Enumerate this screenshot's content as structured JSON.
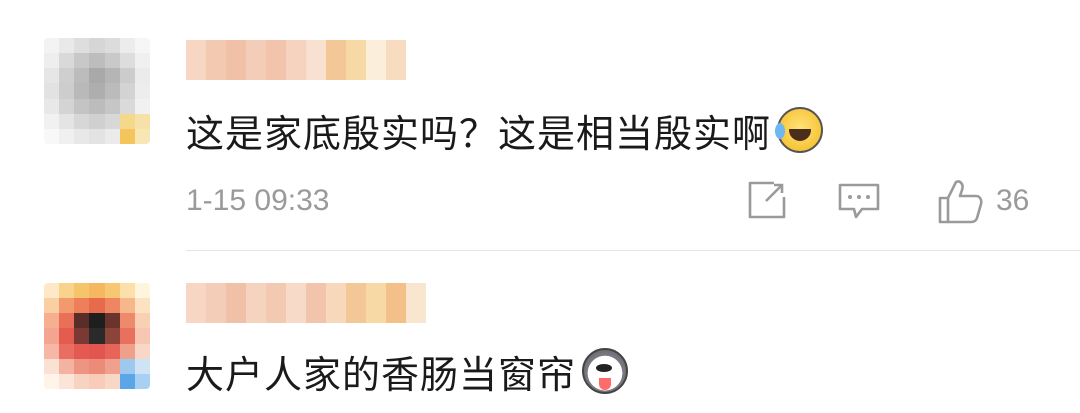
{
  "comments": [
    {
      "username": "",
      "text": "这是家底殷实吗？这是相当殷实啊",
      "emoji": "laughing-crying-emoji",
      "timestamp": "1-15 09:33",
      "like_count": "36",
      "avatar_colors": [
        "#f3f3f3",
        "#e9e9e9",
        "#dedede",
        "#d6d6d6",
        "#dcdcdc",
        "#ececec",
        "#f6f6f6",
        "#eeeeee",
        "#d9d9d9",
        "#c8c8c8",
        "#bdbdbd",
        "#c9c9c9",
        "#dddddd",
        "#f0f0f0",
        "#e6e6e6",
        "#cfcfcf",
        "#bcbcbc",
        "#a9a9a9",
        "#b5b5b5",
        "#cccccc",
        "#ebebeb",
        "#e2e2e2",
        "#cdcdcd",
        "#b9b9b9",
        "#aeaeae",
        "#bbbbbb",
        "#d3d3d3",
        "#ededed",
        "#e8e8e8",
        "#d4d4d4",
        "#c4c4c4",
        "#bcbcbc",
        "#c6c6c6",
        "#dadada",
        "#f1f1f1",
        "#f1f1f1",
        "#e4e4e4",
        "#d7d7d7",
        "#d0d0d0",
        "#d8d8d8",
        "#f4d98a",
        "#f6e2a8",
        "#f8f8f8",
        "#f0f0f0",
        "#e8e8e8",
        "#e3e3e3",
        "#ebebeb",
        "#f3c55c",
        "#f8e6b4"
      ],
      "username_colors": [
        "#f7d6c4",
        "#f3c9b2",
        "#f0c1a6",
        "#f4cdb8",
        "#f2c4ac",
        "#f6d3bf",
        "#f9e1d2",
        "#f4c896",
        "#f7d9a6",
        "#fbeedb",
        "#f8dcc0"
      ]
    },
    {
      "username": "",
      "text": "大户人家的香肠当窗帘",
      "emoji": "husky-dog-emoji",
      "avatar_colors": [
        "#fde8c8",
        "#f9d28b",
        "#f6c46a",
        "#f5b860",
        "#f7c774",
        "#fbe0aa",
        "#fff4de",
        "#fad0a2",
        "#f29a6d",
        "#ef7f5a",
        "#e86a4c",
        "#ee8661",
        "#f6b88a",
        "#fde2c2",
        "#f6b08f",
        "#ea6f57",
        "#5a2e28",
        "#1e1e1e",
        "#6a342d",
        "#ee8a6c",
        "#f9d0b4",
        "#f3a591",
        "#e45c4f",
        "#7a3a33",
        "#2a2a2a",
        "#8a4438",
        "#e9705e",
        "#f7c7b3",
        "#f6b7a6",
        "#e86e61",
        "#e45a52",
        "#e35650",
        "#e7645a",
        "#eea08a",
        "#f9d7c6",
        "#fbe0d4",
        "#f4b2a1",
        "#ee9482",
        "#ec8b78",
        "#f0a18e",
        "#9fc8ee",
        "#cfe3f6",
        "#fff3ea",
        "#fce4d6",
        "#f9d3c1",
        "#f8ccb8",
        "#f9d7c6",
        "#5aa6e8",
        "#a9d0f2"
      ],
      "username_colors": [
        "#f7d6c4",
        "#f4cdb8",
        "#f0c1a6",
        "#f6d3bf",
        "#f3c9b2",
        "#f7dac8",
        "#f2c4ac",
        "#f8d8bb",
        "#f4c896",
        "#f7d9a6",
        "#f3c08a",
        "#f9e6cf"
      ]
    }
  ],
  "icons": {
    "share": "share-icon",
    "comment": "comment-icon",
    "like": "thumbs-up-icon"
  },
  "colors": {
    "text": "#1a1a1a",
    "meta": "#9a9a9a",
    "divider": "#e5e5e5"
  }
}
